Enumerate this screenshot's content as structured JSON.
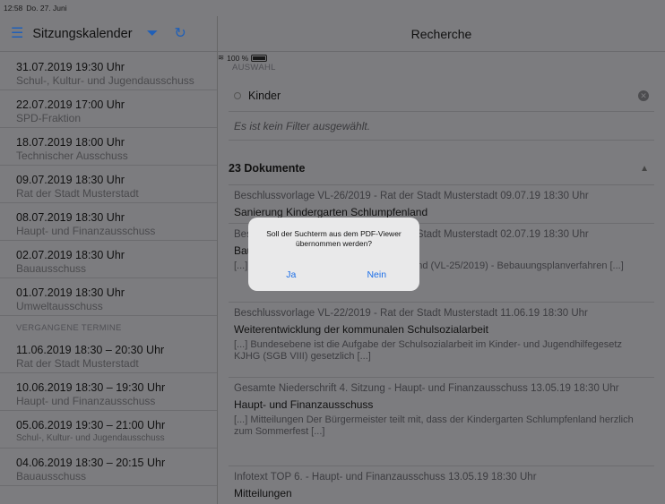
{
  "status": {
    "time": "12:58",
    "date": "Do. 27. Juni",
    "battery": "100 %"
  },
  "left_header": {
    "title": "Sitzungskalender",
    "menu_icon": "hamburger-icon",
    "filter_icon": "filter-icon",
    "refresh_icon": "refresh-icon"
  },
  "right_header": {
    "title": "Recherche"
  },
  "upcoming": [
    {
      "date": "31.07.2019 19:30 Uhr",
      "name": "Schul-, Kultur- und Jugendausschuss"
    },
    {
      "date": "22.07.2019 17:00 Uhr",
      "name": "SPD-Fraktion"
    },
    {
      "date": "18.07.2019 18:00 Uhr",
      "name": "Technischer Ausschuss"
    },
    {
      "date": "09.07.2019 18:30 Uhr",
      "name": "Rat der Stadt Musterstadt"
    },
    {
      "date": "08.07.2019 18:30 Uhr",
      "name": "Haupt- und Finanzausschuss"
    },
    {
      "date": "02.07.2019 18:30 Uhr",
      "name": "Bauausschuss"
    },
    {
      "date": "01.07.2019 18:30 Uhr",
      "name": "Umweltausschuss"
    }
  ],
  "past_label": "VERGANGENE TERMINE",
  "past": [
    {
      "date": "11.06.2019 18:30 – 20:30 Uhr",
      "name": "Rat der Stadt Musterstadt"
    },
    {
      "date": "10.06.2019 18:30 – 19:30 Uhr",
      "name": "Haupt- und Finanzausschuss"
    },
    {
      "date": "05.06.2019 19:30 – 21:00 Uhr",
      "name": "Schul-, Kultur- und Jugendausschuss"
    },
    {
      "date": "04.06.2019 18:30 – 20:15 Uhr",
      "name": "Bauausschuss"
    }
  ],
  "search": {
    "section_label": "AUSWAHL",
    "value": "Kinder",
    "filter_text": "Es ist kein Filter ausgewählt."
  },
  "documents": {
    "count_label": "23 Dokumente",
    "items": [
      {
        "meta": "Beschlussvorlage VL-26/2019 - Rat der Stadt Musterstadt 09.07.19 18:30 Uhr",
        "title": "Sanierung Kindergarten Schlumpfenland",
        "snippet": ""
      },
      {
        "meta": "Beschlussvorlage VL-25/2019 - Rat der Stadt Musterstadt 02.07.19 18:30 Uhr",
        "title": "Bauleitplanung",
        "snippet": "[...] Sanierung Kindergarten Schlumpfenland (VL-25/2019) - Bebauungsplanverfahren [...]"
      },
      {
        "meta": "Beschlussvorlage VL-22/2019 - Rat der Stadt Musterstadt 11.06.19 18:30 Uhr",
        "title": "Weiterentwicklung der kommunalen Schulsozialarbeit",
        "snippet": "[...] Bundesebene ist die Aufgabe der Schulsozialarbeit im Kinder- und Jugendhilfegesetz KJHG (SGB VIII) gesetzlich [...]"
      },
      {
        "meta": "Gesamte Niederschrift 4. Sitzung - Haupt- und Finanzausschuss 13.05.19 18:30 Uhr",
        "title": "Haupt- und Finanzausschuss",
        "snippet": "[...] Mitteilungen Der Bürgermeister teilt mit, dass der Kindergarten Schlumpfenland herzlich zum Sommerfest [...]"
      },
      {
        "meta": "Infotext TOP 6. - Haupt- und Finanzausschuss 13.05.19 18:30 Uhr",
        "title": "Mitteilungen",
        "snippet": ""
      }
    ]
  },
  "dialog": {
    "message": "Soll der Suchterm aus dem PDF-Viewer übernommen werden?",
    "yes": "Ja",
    "no": "Nein"
  }
}
